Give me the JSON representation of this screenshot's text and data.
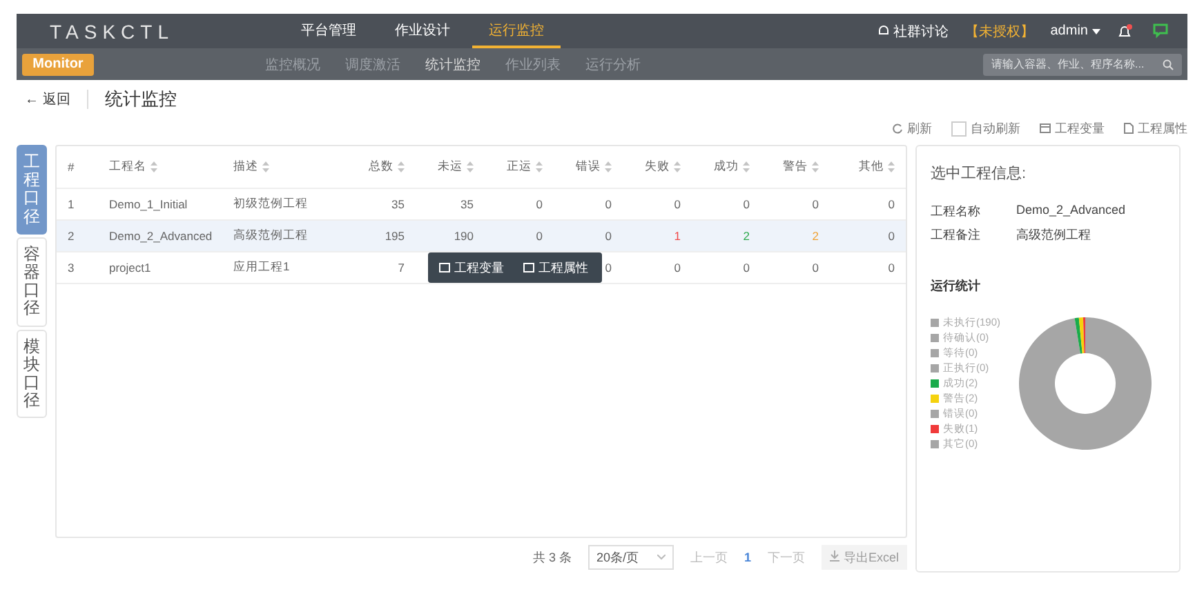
{
  "header": {
    "logo": "TASKCTL",
    "nav": [
      {
        "label": "平台管理",
        "selected": false
      },
      {
        "label": "作业设计",
        "selected": false
      },
      {
        "label": "运行监控",
        "selected": true
      }
    ],
    "community": "社群讨论",
    "license": "【未授权】",
    "user": "admin",
    "notification": true
  },
  "subnav": {
    "module": "Monitor",
    "items": [
      {
        "label": "监控概况",
        "selected": false
      },
      {
        "label": "调度激活",
        "selected": false
      },
      {
        "label": "统计监控",
        "selected": true
      },
      {
        "label": "作业列表",
        "selected": false
      },
      {
        "label": "运行分析",
        "selected": false
      }
    ],
    "search": {
      "placeholder": "请输入容器、作业、程序名称..."
    }
  },
  "page": {
    "back": "← 返回",
    "title": "统计监控"
  },
  "toolbar": {
    "refresh": "刷新",
    "auto_refresh": {
      "label": "自动刷新",
      "checked": false
    },
    "variables": "工程变量",
    "properties": "工程属性"
  },
  "side_tabs": [
    {
      "label": "工程口径",
      "selected": true
    },
    {
      "label": "容器口径",
      "selected": false
    },
    {
      "label": "模块口径",
      "selected": false
    }
  ],
  "table": {
    "columns": [
      {
        "label": "#",
        "sortable": false
      },
      {
        "label": "工程名",
        "sortable": true
      },
      {
        "label": "描述",
        "sortable": true
      },
      {
        "label": "总数",
        "sortable": true
      },
      {
        "label": "未运",
        "sortable": true
      },
      {
        "label": "正运",
        "sortable": true
      },
      {
        "label": "错误",
        "sortable": true
      },
      {
        "label": "失败",
        "sortable": true
      },
      {
        "label": "成功",
        "sortable": true
      },
      {
        "label": "警告",
        "sortable": true
      },
      {
        "label": "其他",
        "sortable": true
      }
    ],
    "rows": [
      {
        "selected": false,
        "cells": [
          {
            "text": "1"
          },
          {
            "text": "Demo_1_Initial"
          },
          {
            "text": "初级范例工程"
          },
          {
            "text": "35"
          },
          {
            "text": "35"
          },
          {
            "text": "0"
          },
          {
            "text": "0"
          },
          {
            "text": "0"
          },
          {
            "text": "0"
          },
          {
            "text": "0"
          },
          {
            "text": "0"
          }
        ]
      },
      {
        "selected": true,
        "cells": [
          {
            "text": "2"
          },
          {
            "text": "Demo_2_Advanced"
          },
          {
            "text": "高级范例工程"
          },
          {
            "text": "195"
          },
          {
            "text": "190"
          },
          {
            "text": "0"
          },
          {
            "text": "0"
          },
          {
            "text": "1",
            "color": "#f04848"
          },
          {
            "text": "2",
            "color": "#2aa84a"
          },
          {
            "text": "2",
            "color": "#f0a030"
          },
          {
            "text": "0"
          }
        ]
      },
      {
        "selected": false,
        "cells": [
          {
            "text": "3"
          },
          {
            "text": "project1"
          },
          {
            "text": "应用工程1"
          },
          {
            "text": "7"
          },
          null,
          null,
          {
            "text": "0"
          },
          {
            "text": "0"
          },
          {
            "text": "0"
          },
          {
            "text": "0"
          },
          {
            "text": "0"
          }
        ]
      }
    ],
    "context_menu": [
      "工程变量",
      "工程属性"
    ],
    "pagination": {
      "total": "共 3 条",
      "page_size": "20条/页",
      "prev": "上一页",
      "page": "1",
      "next": "下一页",
      "export": "导出Excel"
    }
  },
  "info_panel": {
    "title": "选中工程信息:",
    "fields": [
      {
        "label": "工程名称",
        "value": "Demo_2_Advanced"
      },
      {
        "label": "工程备注",
        "value": "高级范例工程"
      }
    ],
    "stats_title": "运行统计",
    "chart_data": {
      "type": "donut",
      "categories": [
        "未执行(190)",
        "待确认(0)",
        "等待(0)",
        "正执行(0)",
        "成功(2)",
        "警告(2)",
        "错误(0)",
        "失败(1)",
        "其它(0)"
      ],
      "values": [
        190,
        0,
        0,
        0,
        2,
        2,
        0,
        1,
        0
      ],
      "colors": [
        "#a6a6a6",
        "#a6a6a6",
        "#a6a6a6",
        "#a6a6a6",
        "#1aab4b",
        "#f5d20e",
        "#a6a6a6",
        "#f03a3a",
        "#a6a6a6"
      ]
    }
  }
}
